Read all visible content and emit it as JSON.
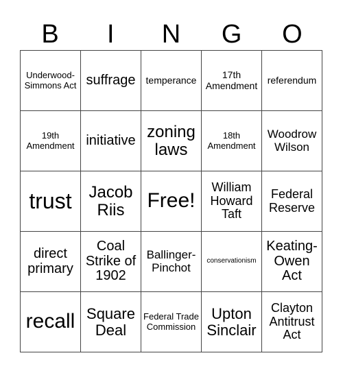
{
  "header": {
    "letters": [
      "B",
      "I",
      "N",
      "G",
      "O"
    ]
  },
  "grid": [
    [
      "Underwood-Simmons Act",
      "suffrage",
      "temperance",
      "17th Amendment",
      "referendum"
    ],
    [
      "19th Amendment",
      "initiative",
      "zoning laws",
      "18th Amendment",
      "Woodrow Wilson"
    ],
    [
      "trust",
      "Jacob Riis",
      "Free!",
      "William Howard Taft",
      "Federal Reserve"
    ],
    [
      "direct primary",
      "Coal Strike of 1902",
      "Ballinger-Pinchot",
      "conservationism",
      "Keating-Owen Act"
    ],
    [
      "recall",
      "Square Deal",
      "Federal Trade Commission",
      "Upton Sinclair",
      "Clayton Antitrust Act"
    ]
  ]
}
